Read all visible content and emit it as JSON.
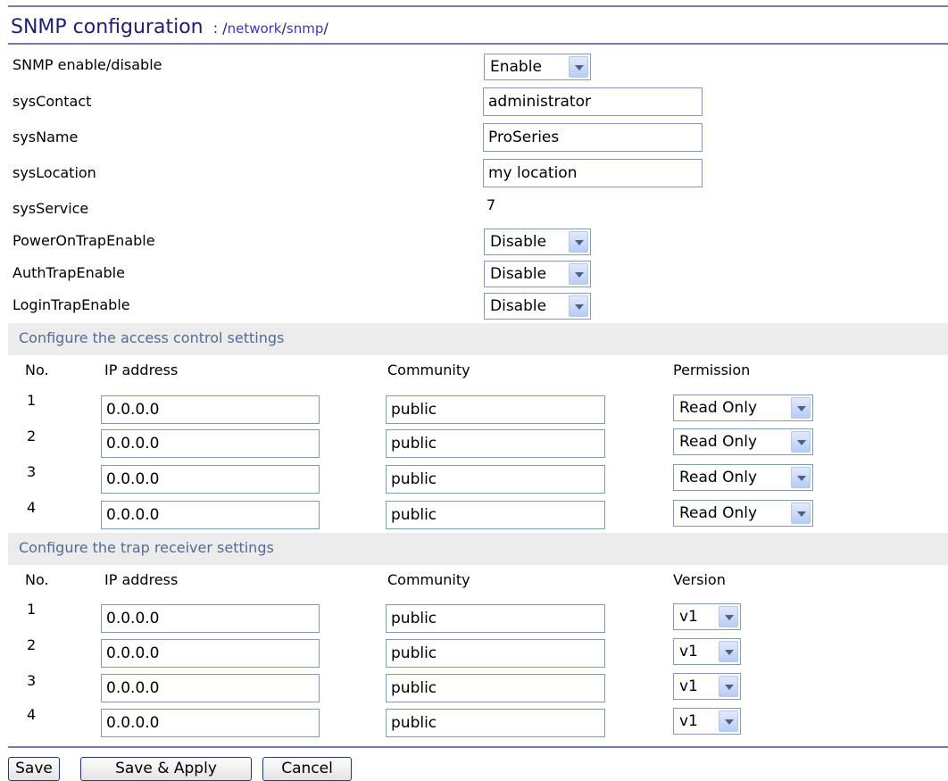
{
  "header": {
    "title": "SNMP configuration",
    "separator": ":",
    "path_seg1": "network",
    "path_seg2": "snmp",
    "slash": "/"
  },
  "general": {
    "snmp_enable": {
      "label": "SNMP enable/disable",
      "value": "Enable"
    },
    "sys_contact": {
      "label": "sysContact",
      "value": "administrator"
    },
    "sys_name": {
      "label": "sysName",
      "value": "ProSeries"
    },
    "sys_location": {
      "label": "sysLocation",
      "value": "my location"
    },
    "sys_service": {
      "label": "sysService",
      "value": "7"
    },
    "power_on_trap": {
      "label": "PowerOnTrapEnable",
      "value": "Disable"
    },
    "auth_trap": {
      "label": "AuthTrapEnable",
      "value": "Disable"
    },
    "login_trap": {
      "label": "LoginTrapEnable",
      "value": "Disable"
    }
  },
  "access": {
    "title": "Configure the access control settings",
    "headers": {
      "no": "No.",
      "ip": "IP address",
      "community": "Community",
      "permission": "Permission"
    },
    "rows": [
      {
        "no": "1",
        "ip": "0.0.0.0",
        "community": "public",
        "permission": "Read Only"
      },
      {
        "no": "2",
        "ip": "0.0.0.0",
        "community": "public",
        "permission": "Read Only"
      },
      {
        "no": "3",
        "ip": "0.0.0.0",
        "community": "public",
        "permission": "Read Only"
      },
      {
        "no": "4",
        "ip": "0.0.0.0",
        "community": "public",
        "permission": "Read Only"
      }
    ]
  },
  "trap": {
    "title": "Configure the trap receiver settings",
    "headers": {
      "no": "No.",
      "ip": "IP address",
      "community": "Community",
      "version": "Version"
    },
    "rows": [
      {
        "no": "1",
        "ip": "0.0.0.0",
        "community": "public",
        "version": "v1"
      },
      {
        "no": "2",
        "ip": "0.0.0.0",
        "community": "public",
        "version": "v1"
      },
      {
        "no": "3",
        "ip": "0.0.0.0",
        "community": "public",
        "version": "v1"
      },
      {
        "no": "4",
        "ip": "0.0.0.0",
        "community": "public",
        "version": "v1"
      }
    ]
  },
  "buttons": {
    "save": "Save",
    "save_apply": "Save & Apply",
    "cancel": "Cancel"
  },
  "colors": {
    "accent": "#202070",
    "section_bg": "#ececec",
    "rule": "#7a7aa6"
  },
  "icons": {
    "select_arrow": "chevron-down-icon"
  }
}
